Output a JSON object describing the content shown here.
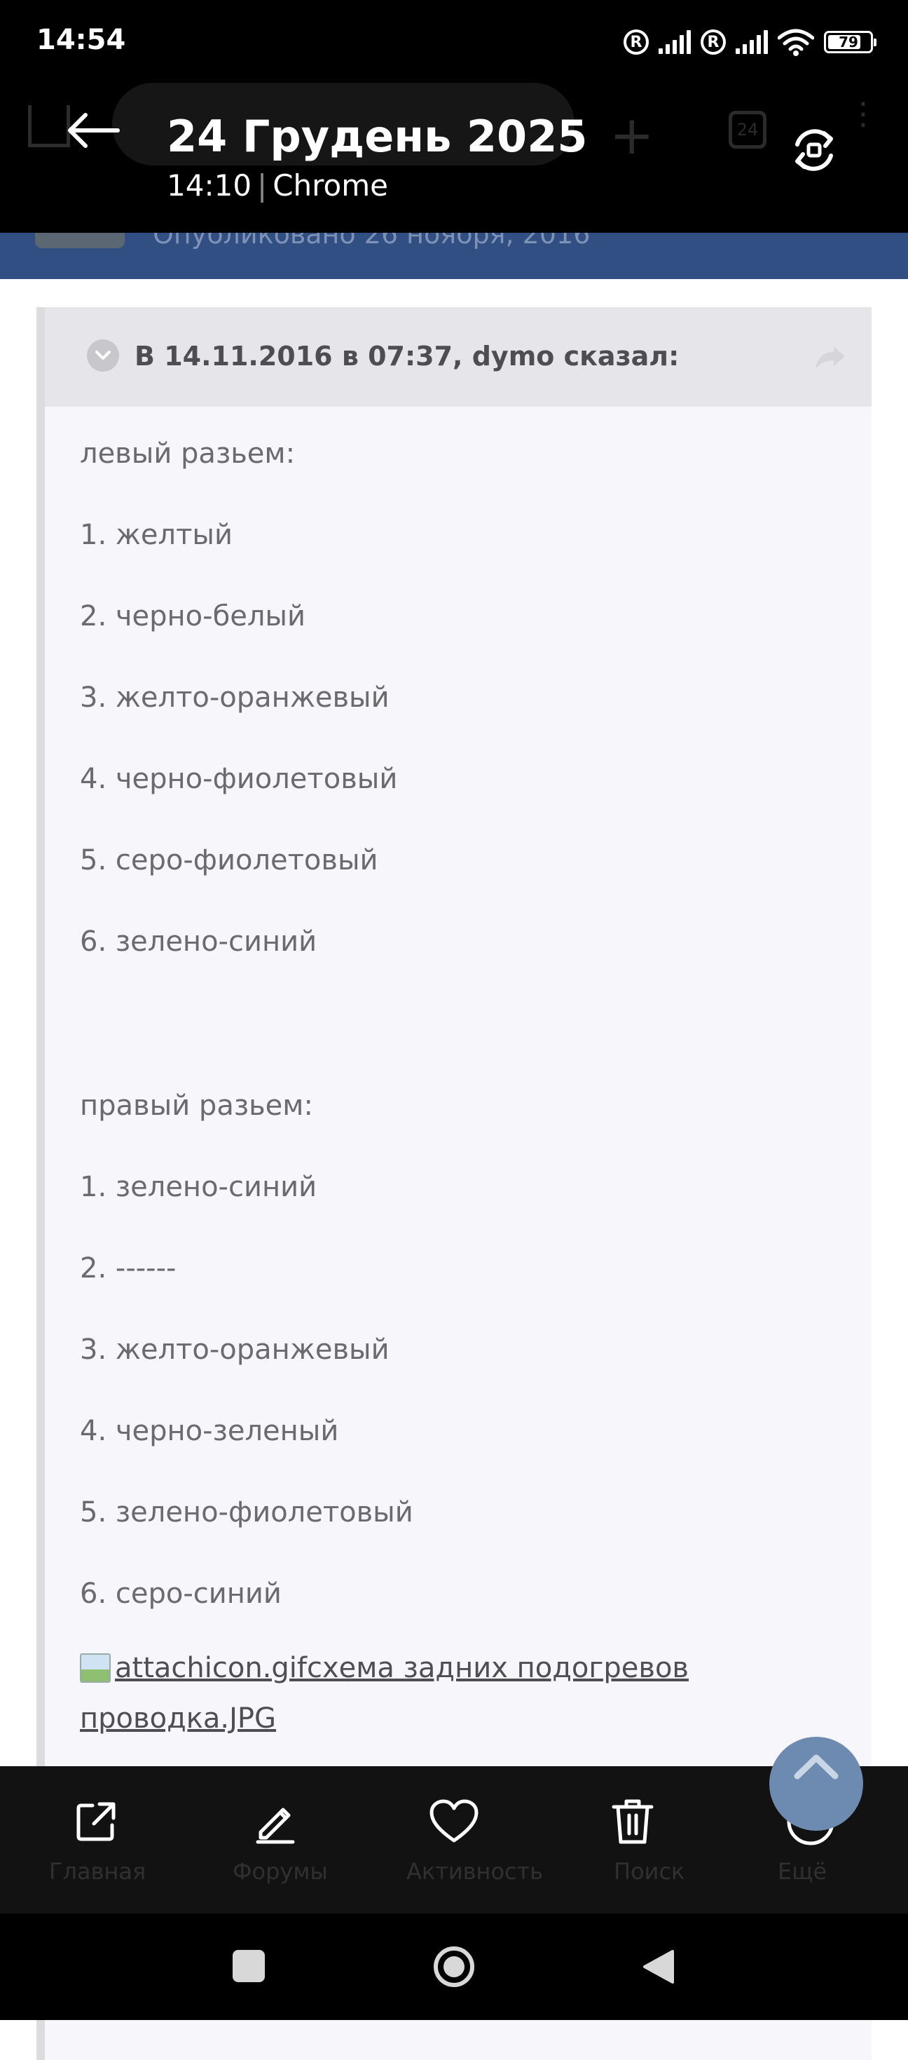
{
  "status_bar": {
    "time": "14:54",
    "battery": "79",
    "battery_fraction": 0.79,
    "icons": [
      "registered-icon",
      "signal-icon",
      "registered-icon",
      "signal-icon",
      "wifi-icon",
      "battery-icon"
    ]
  },
  "gallery_header": {
    "date": "24 Грудень 2025",
    "time": "14:10",
    "separator": "|",
    "app": "Chrome"
  },
  "background_page": {
    "tab_count": "24",
    "published_text": "Опубликовано 26 ноября, 2016"
  },
  "quote": {
    "title": "В 14.11.2016 в 07:37, dymo сказал:",
    "lines": [
      "левый разьем:",
      "1. желтый",
      "2. черно-белый",
      "3. желто-оранжевый",
      "4. черно-фиолетовый",
      "5. серо-фиолетовый",
      "6. зелено-синий",
      "правый разьем:",
      "1. зелено-синий",
      "2. ------",
      "3. желто-оранжевый",
      "4. черно-зеленый",
      "5. зелено-фиолетовый",
      "6. серо-синий"
    ],
    "attachment_alt": "attachicon.gif",
    "attachment_name_1": "схема задних подогревов",
    "attachment_name_2": "проводка.JPG"
  },
  "ghost_nav_labels": [
    "Главная",
    "Форумы",
    "Активность",
    "Поиск",
    "Ещё"
  ],
  "toolbar": {
    "icons": [
      "share-icon",
      "edit-icon",
      "favorite-icon",
      "delete-icon",
      "more-icon"
    ]
  },
  "colors": {
    "forum_band": "#314f82",
    "quote_bg": "#f7f6fa",
    "quote_header": "#e6e6ea",
    "toolbar_bg": "#121212"
  }
}
